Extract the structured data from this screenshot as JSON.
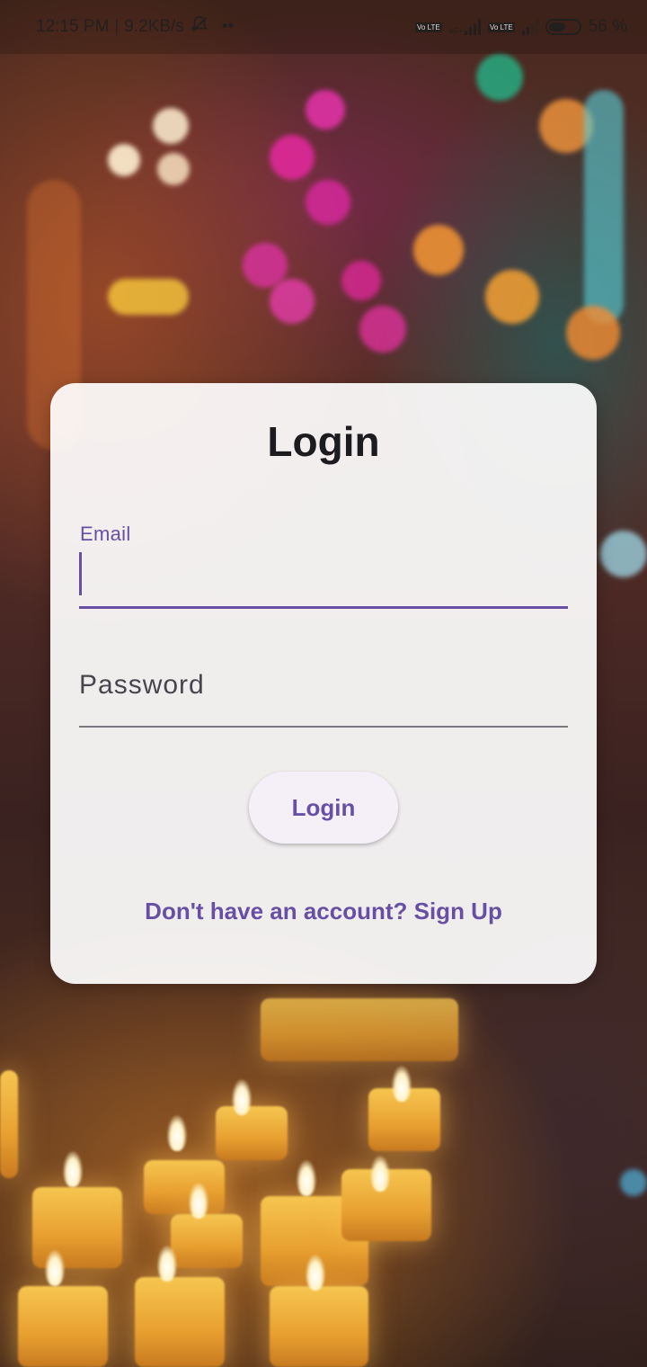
{
  "status_bar": {
    "time": "12:15 PM",
    "net_speed": "9.2KB/s",
    "dnd_icon": "bell-off-icon",
    "more_icon": "more-dots-icon",
    "network_type": "4G+",
    "volte_label": "Vo LTE",
    "battery_percent": "56",
    "battery_level": 0.56
  },
  "login": {
    "title": "Login",
    "email_label": "Email",
    "email_value": "",
    "password_placeholder": "Password",
    "login_button": "Login",
    "signup_link": "Don't have an account? Sign Up"
  },
  "colors": {
    "accent": "#6750a4",
    "card_bg": "#ffffff",
    "button_bg": "#f5eff7"
  }
}
